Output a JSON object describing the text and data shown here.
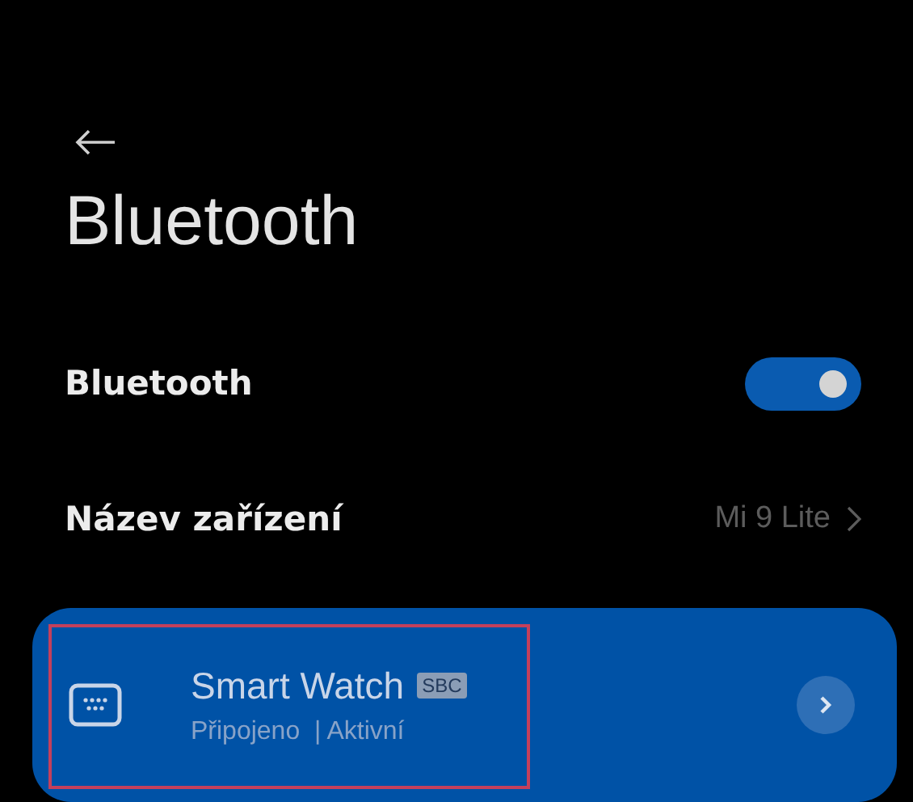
{
  "header": {
    "title": "Bluetooth"
  },
  "bluetooth": {
    "label": "Bluetooth",
    "on": true
  },
  "device_name": {
    "label": "Název zařízení",
    "value": "Mi 9 Lite"
  },
  "devices": [
    {
      "name": "Smart Watch",
      "codec": "SBC",
      "status": "Připojeno  | Aktivní",
      "highlighted": true
    }
  ]
}
